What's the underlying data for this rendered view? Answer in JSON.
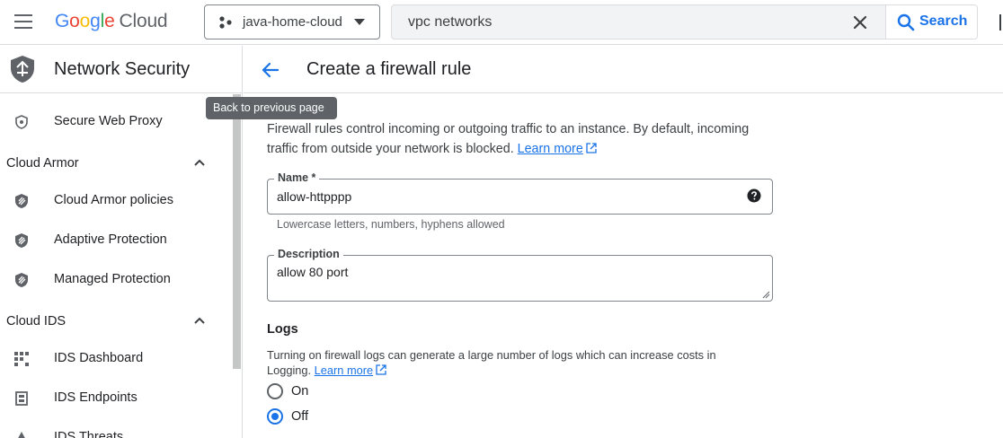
{
  "topbar": {
    "logo": {
      "g": "G",
      "o1": "o",
      "o2": "o",
      "g2": "g",
      "l": "l",
      "e": "e",
      "cloud": "Cloud"
    },
    "project": "java-home-cloud",
    "search": {
      "value": "vpc networks",
      "button_label": "Search"
    }
  },
  "sidebar": {
    "title": "Network Security",
    "items": [
      {
        "label": "Secure Web Proxy",
        "icon": "proxy-icon"
      },
      {
        "group": "Cloud Armor"
      },
      {
        "label": "Cloud Armor policies",
        "icon": "shield-icon"
      },
      {
        "label": "Adaptive Protection",
        "icon": "shield-icon"
      },
      {
        "label": "Managed Protection",
        "icon": "shield-icon"
      },
      {
        "group": "Cloud IDS"
      },
      {
        "label": "IDS Dashboard",
        "icon": "dashboard-icon"
      },
      {
        "label": "IDS Endpoints",
        "icon": "endpoint-icon"
      },
      {
        "label": "IDS Threats",
        "icon": "threat-icon"
      }
    ]
  },
  "main": {
    "title": "Create a firewall rule",
    "tooltip": "Back to previous page",
    "intro_line1": "Firewall rules control incoming or outgoing traffic to an instance. By default, incoming",
    "intro_line2": "traffic from outside your network is blocked.",
    "learn_more": "Learn more",
    "name_field": {
      "label": "Name *",
      "value": "allow-httpppp",
      "hint": "Lowercase letters, numbers, hyphens allowed"
    },
    "description_field": {
      "label": "Description",
      "value": "allow 80 port"
    },
    "logs": {
      "title": "Logs",
      "desc_line1": "Turning on firewall logs can generate a large number of logs which can increase costs in",
      "desc_line2": "Logging.",
      "learn_more": "Learn more",
      "options": [
        "On",
        "Off"
      ],
      "selected": "Off"
    }
  },
  "colors": {
    "accent": "#1a73e8",
    "text": "#202124",
    "border": "#dadce0"
  }
}
